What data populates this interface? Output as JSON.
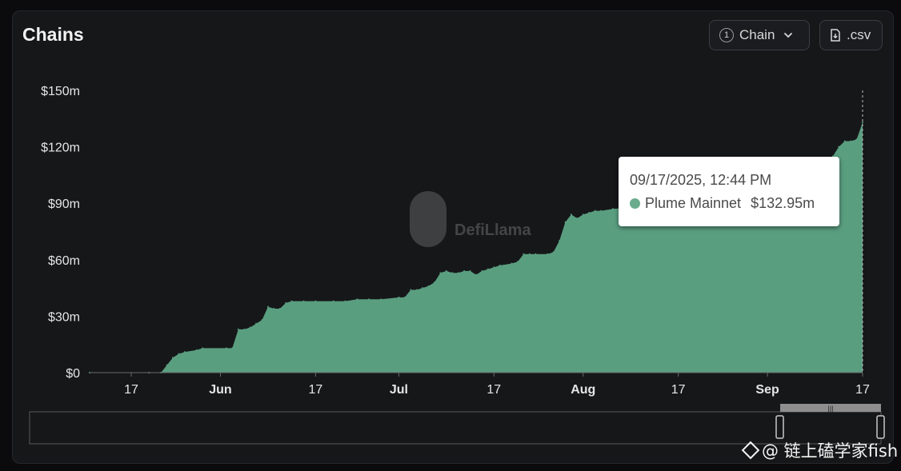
{
  "header": {
    "title": "Chains",
    "chain_button": {
      "badge": "1",
      "label": "Chain"
    },
    "csv_button": {
      "label": ".csv"
    }
  },
  "watermark_logo": "DefiLlama",
  "tooltip": {
    "date": "09/17/2025, 12:44 PM",
    "series": "Plume Mainnet",
    "value": "$132.95m"
  },
  "credit": {
    "text": "@ 链上磕学家fish"
  },
  "colors": {
    "area": "#5a9e80",
    "tooltip_dot": "#6aab8e",
    "background": "#161719"
  },
  "chart_data": {
    "type": "area",
    "xlabel": "",
    "ylabel": "",
    "x_tick_labels": [
      "17",
      "Jun",
      "17",
      "Jul",
      "17",
      "Aug",
      "17",
      "Sep",
      "17"
    ],
    "x_tick_dates": [
      "2025-05-17",
      "2025-06-01",
      "2025-06-17",
      "2025-07-01",
      "2025-07-17",
      "2025-08-01",
      "2025-08-17",
      "2025-09-01",
      "2025-09-17"
    ],
    "y_tick_labels": [
      "$0",
      "$30m",
      "$60m",
      "$90m",
      "$120m",
      "$150m"
    ],
    "y_ticks": [
      0,
      30,
      60,
      90,
      120,
      150
    ],
    "ylim": [
      0,
      150
    ],
    "x_range": [
      "2025-05-10",
      "2025-09-17"
    ],
    "series": [
      {
        "name": "Plume Mainnet",
        "unit": "USD millions",
        "points": [
          [
            "2025-05-10",
            0
          ],
          [
            "2025-05-20",
            0
          ],
          [
            "2025-05-22",
            0
          ],
          [
            "2025-05-23",
            4
          ],
          [
            "2025-05-24",
            8
          ],
          [
            "2025-05-25",
            10
          ],
          [
            "2025-05-26",
            11
          ],
          [
            "2025-05-28",
            12
          ],
          [
            "2025-05-29",
            13
          ],
          [
            "2025-06-02",
            13
          ],
          [
            "2025-06-03",
            13
          ],
          [
            "2025-06-04",
            23
          ],
          [
            "2025-06-05",
            23
          ],
          [
            "2025-06-06",
            24
          ],
          [
            "2025-06-07",
            26
          ],
          [
            "2025-06-08",
            28
          ],
          [
            "2025-06-09",
            35
          ],
          [
            "2025-06-10",
            34
          ],
          [
            "2025-06-11",
            34
          ],
          [
            "2025-06-12",
            37
          ],
          [
            "2025-06-13",
            38
          ],
          [
            "2025-06-15",
            38
          ],
          [
            "2025-06-17",
            38
          ],
          [
            "2025-06-20",
            38
          ],
          [
            "2025-06-22",
            38
          ],
          [
            "2025-06-24",
            39
          ],
          [
            "2025-06-26",
            39
          ],
          [
            "2025-06-28",
            39
          ],
          [
            "2025-07-01",
            40
          ],
          [
            "2025-07-02",
            40
          ],
          [
            "2025-07-03",
            44
          ],
          [
            "2025-07-04",
            44
          ],
          [
            "2025-07-05",
            45
          ],
          [
            "2025-07-06",
            46
          ],
          [
            "2025-07-07",
            48
          ],
          [
            "2025-07-08",
            53
          ],
          [
            "2025-07-09",
            54
          ],
          [
            "2025-07-10",
            53
          ],
          [
            "2025-07-11",
            53
          ],
          [
            "2025-07-12",
            54
          ],
          [
            "2025-07-13",
            54
          ],
          [
            "2025-07-14",
            52
          ],
          [
            "2025-07-15",
            54
          ],
          [
            "2025-07-16",
            55
          ],
          [
            "2025-07-17",
            56
          ],
          [
            "2025-07-18",
            57
          ],
          [
            "2025-07-20",
            58
          ],
          [
            "2025-07-21",
            59
          ],
          [
            "2025-07-22",
            63
          ],
          [
            "2025-07-23",
            63
          ],
          [
            "2025-07-24",
            63
          ],
          [
            "2025-07-26",
            63
          ],
          [
            "2025-07-27",
            64
          ],
          [
            "2025-07-28",
            70
          ],
          [
            "2025-07-29",
            80
          ],
          [
            "2025-07-30",
            84
          ],
          [
            "2025-07-31",
            82
          ],
          [
            "2025-08-01",
            84
          ],
          [
            "2025-08-02",
            85
          ],
          [
            "2025-08-03",
            86
          ],
          [
            "2025-08-04",
            86
          ],
          [
            "2025-08-06",
            87
          ],
          [
            "2025-08-10",
            88
          ],
          [
            "2025-08-15",
            89
          ],
          [
            "2025-08-20",
            90
          ],
          [
            "2025-08-25",
            92
          ],
          [
            "2025-08-31",
            95
          ],
          [
            "2025-09-04",
            98
          ],
          [
            "2025-09-08",
            104
          ],
          [
            "2025-09-10",
            108
          ],
          [
            "2025-09-12",
            115
          ],
          [
            "2025-09-13",
            120
          ],
          [
            "2025-09-14",
            123
          ],
          [
            "2025-09-15",
            123
          ],
          [
            "2025-09-16",
            124
          ],
          [
            "2025-09-17",
            132.95
          ]
        ]
      }
    ],
    "hover_date": "2025-09-17",
    "grid": false,
    "legend": "none"
  }
}
